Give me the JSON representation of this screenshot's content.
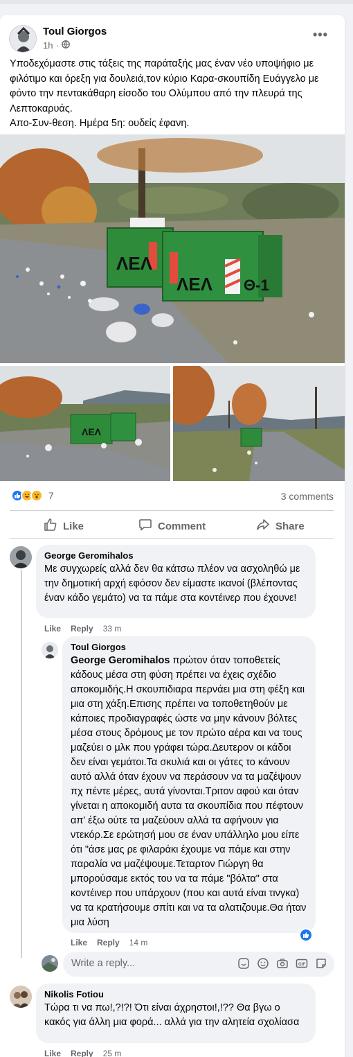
{
  "post": {
    "author": "Toul Giorgos",
    "time": "1h",
    "privacy_icon": "globe-icon",
    "more_icon": "ellipsis-icon",
    "text_lines": [
      "Υποδεχόμαστε στις τάξεις της παράταξής μας έναν νέο υποψήφιο με φιλότιμο και όρεξη για δουλειά,τον κύριο Καρα-σκουπίδη Ευάγγελο με φόντο την πεντακάθαρη είσοδο του Ολύμπου από την πλευρά της Λεπτοκαρυάς.",
      "Απο-Συν-θεση. Ημέρα 5η: ουδείς έφανη."
    ],
    "container_labels": [
      "ΛΕΛ",
      "ΛΕΛ",
      "Θ-1"
    ]
  },
  "stats": {
    "reaction_count": "7",
    "reaction_icons": [
      "like-icon",
      "laugh-icon",
      "wow-icon"
    ],
    "comments_label": "3 comments"
  },
  "actions": {
    "like": "Like",
    "comment": "Comment",
    "share": "Share"
  },
  "comments": [
    {
      "author": "George Geromihalos",
      "text": "Με συγχωρείς αλλά δεν θα κάτσω πλέον να ασχοληθώ με την δημοτική αρχή εφόσον δεν είμαστε ικανοί (βλέποντας έναν κάδο γεμάτο) να τα πάμε στα κοντέινερ που έχουνε!",
      "like": "Like",
      "reply": "Reply",
      "time": "33 m"
    },
    {
      "author": "Toul Giorgos",
      "mention": "George Geromihalos",
      "text": " πρώτον όταν τοποθετείς κάδους μέσα στη φύση πρέπει να έχεις σχέδιο αποκομιδής.Η σκουπιδιαρα περνάει μια στη φέξη και μια στη χάξη.Επισης πρέπει να τοποθετηθούν με κάποιες προδιαγραφές ώστε να μην κάνουν βόλτες μέσα στους δρόμους με τον πρώτο αέρα και να τους μαζεύει ο μλκ που γράφει τώρα.Δευτερον οι κάδοι δεν είναι γεμάτοι.Τα σκυλιά και οι γάτες το κάνουν αυτό αλλά όταν έχουν να περάσουν να τα μαζέψουν πχ πέντε μέρες, αυτά γίνονται.Τριτον αφού και όταν γίνεται η αποκομιδή αυτα τα σκουπίδια που πέφτουν απ' έξω ούτε τα μαζεύουν αλλά τα αφήνουν για ντεκόρ.Σε ερώτησή μου σε έναν υπάλληλο μου είπε ότι \"άσε μας ρε φιλαράκι έχουμε να πάμε και στην παραλία να μαζέψουμε.Τεταρτον Γιώργη θα μπορούσαμε εκτός του να τα πάμε \"βόλτα\" στα κοντέινερ που υπάρχουν (που και αυτά είναι τινγκα) να τα κρατήσουμε σπίτι και να τα αλατιζουμε.Θα ήταν μια λύση",
      "like": "Like",
      "reply": "Reply",
      "time": "14 m"
    },
    {
      "author": "Nikolis Fotiou",
      "text": "Τώρα τι να πω!,?!?! Ότι είναι άχρηστοι!,!?? Θα βγω ο κακός για άλλη μια φορά... αλλά για την αλητεία σχολίασα",
      "like": "Like",
      "reply": "Reply",
      "time": "25 m"
    }
  ],
  "reply_box": {
    "placeholder": "Write a reply...",
    "icons": [
      "sticker-icon",
      "emoji-icon",
      "camera-icon",
      "gif-icon",
      "avatar-sticker-icon"
    ]
  },
  "colors": {
    "container_green": "#2e8b3a",
    "like_blue": "#1877f2",
    "text_secondary": "#65676b"
  }
}
